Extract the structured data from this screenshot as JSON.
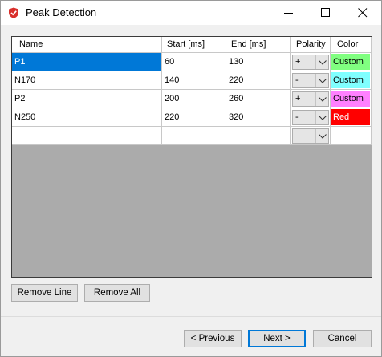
{
  "window": {
    "title": "Peak Detection",
    "icon": "red-shield-check-icon",
    "controls": [
      "minimize-icon",
      "maximize-icon",
      "close-icon"
    ]
  },
  "grid": {
    "columns": [
      "Name",
      "Start [ms]",
      "End [ms]",
      "Polarity",
      "Color"
    ],
    "rows": [
      {
        "name": "P1",
        "start": "60",
        "end": "130",
        "polarity": "+",
        "color_label": "Custom",
        "color": "#80ff80",
        "text_color": "#000000"
      },
      {
        "name": "N170",
        "start": "140",
        "end": "220",
        "polarity": "-",
        "color_label": "Custom",
        "color": "#80ffff",
        "text_color": "#000000"
      },
      {
        "name": "P2",
        "start": "200",
        "end": "260",
        "polarity": "+",
        "color_label": "Custom",
        "color": "#ff80ff",
        "text_color": "#000000"
      },
      {
        "name": "N250",
        "start": "220",
        "end": "320",
        "polarity": "-",
        "color_label": "Red",
        "color": "#ff0000",
        "text_color": "#ffffff"
      },
      {
        "name": "",
        "start": "",
        "end": "",
        "polarity": "",
        "color_label": "",
        "color": "#ffffff",
        "text_color": "#000000"
      }
    ],
    "selected_row": 0,
    "empty_area_color": "#ababab"
  },
  "buttons": {
    "remove_line": "Remove Line",
    "remove_all": "Remove All",
    "previous": "< Previous",
    "next": "Next >",
    "cancel": "Cancel"
  },
  "colors": {
    "selection": "#0078d7",
    "title_icon": "#d9302c"
  }
}
